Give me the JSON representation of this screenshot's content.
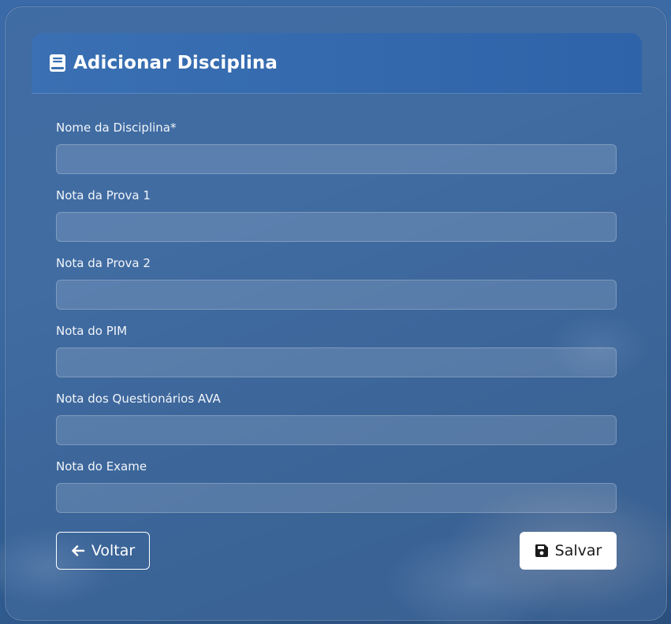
{
  "header": {
    "title": "Adicionar Disciplina",
    "icon": "book-icon"
  },
  "form": {
    "fields": [
      {
        "label": "Nome da Disciplina*",
        "value": "",
        "placeholder": ""
      },
      {
        "label": "Nota da Prova 1",
        "value": "",
        "placeholder": ""
      },
      {
        "label": "Nota da Prova 2",
        "value": "",
        "placeholder": ""
      },
      {
        "label": "Nota do PIM",
        "value": "",
        "placeholder": ""
      },
      {
        "label": "Nota dos Questionários AVA",
        "value": "",
        "placeholder": ""
      },
      {
        "label": "Nota do Exame",
        "value": "",
        "placeholder": ""
      }
    ]
  },
  "actions": {
    "back_label": "Voltar",
    "back_icon": "arrow-left-icon",
    "save_label": "Salvar",
    "save_icon": "floppy-disk-icon"
  },
  "colors": {
    "header_bg": "#3a70b3",
    "save_bg": "#ffffff",
    "text": "#ffffff"
  }
}
